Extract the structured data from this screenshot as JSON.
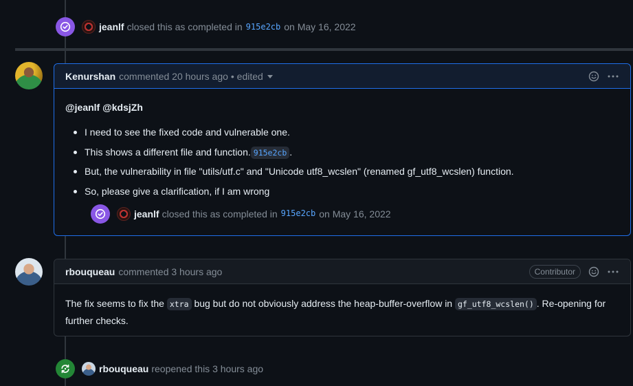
{
  "top_event": {
    "actor": "jeanlf",
    "action": "closed this as completed in",
    "commit": "915e2cb",
    "date": "on May 16, 2022"
  },
  "comment1": {
    "author": "Kenurshan",
    "meta": "commented 20 hours ago",
    "edited": "• edited",
    "mentions": "@jeanlf @kdsjZh",
    "bullets": [
      "I need to see the fixed code and vulnerable one.",
      "This shows a different file and function.",
      "But, the vulnerability in file \"utils/utf.c\" and \"Unicode utf8_wcslen\" (renamed gf_utf8_wcslen) function.",
      "So, please give a clarification, if I am wrong"
    ],
    "bullet2_commit": "915e2cb",
    "bullet2_suffix": ".",
    "nested_event": {
      "actor": "jeanlf",
      "action": "closed this as completed in",
      "commit": "915e2cb",
      "date": "on May 16, 2022"
    }
  },
  "comment2": {
    "author": "rbouqueau",
    "meta": "commented 3 hours ago",
    "badge": "Contributor",
    "text_1": "The fix seems to fix the",
    "code_1": "xtra",
    "text_2": "bug but do not obviously address the heap-buffer-overflow in",
    "code_2": "gf_utf8_wcslen()",
    "text_3": ". Re-opening for further checks."
  },
  "bottom_event": {
    "actor": "rbouqueau",
    "action": "reopened this 3 hours ago"
  },
  "colors": {
    "closed_badge": "#8957e5",
    "reopened_badge": "#238636",
    "link": "#58a6ff",
    "highlight_border": "#1f6feb"
  },
  "icons": [
    "check-circle-icon",
    "reopen-icon",
    "smiley-icon",
    "kebab-icon",
    "caret-down-icon"
  ]
}
